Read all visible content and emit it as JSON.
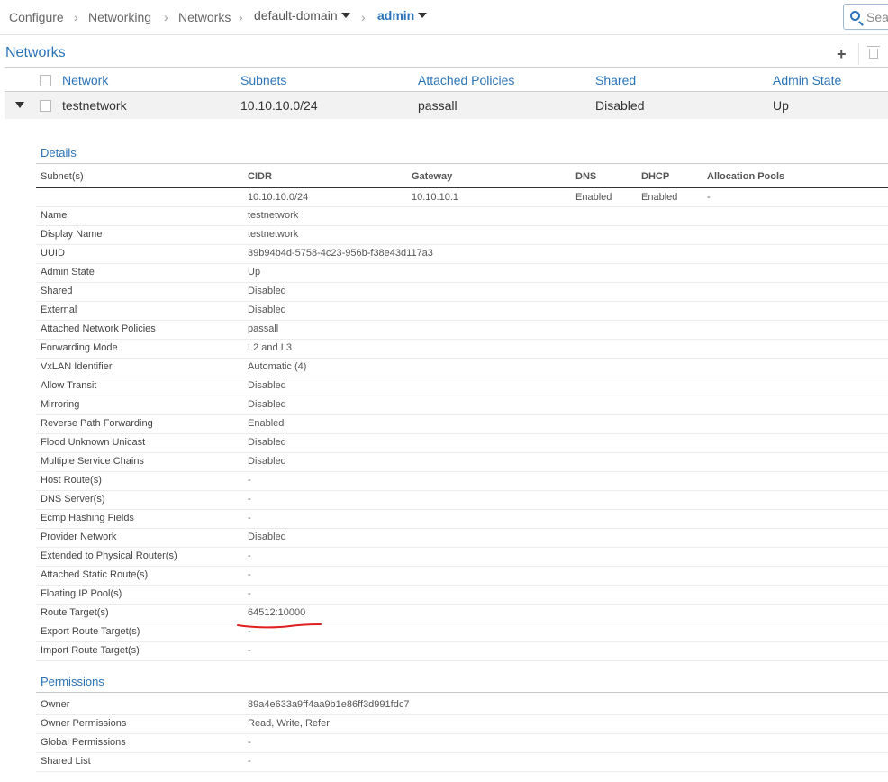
{
  "breadcrumb": {
    "configure": "Configure",
    "networking": "Networking",
    "networks": "Networks",
    "domain": "default-domain",
    "project": "admin",
    "separator": "›"
  },
  "search": {
    "placeholder": "Sear"
  },
  "section_title": "Networks",
  "toolbar": {
    "add_icon": "plus-icon",
    "delete_icon": "trash-icon"
  },
  "grid": {
    "columns": [
      "Network",
      "Subnets",
      "Attached Policies",
      "Shared",
      "Admin State"
    ],
    "rows": [
      {
        "network": "testnetwork",
        "subnets": "10.10.10.0/24",
        "policies": "passall",
        "shared": "Disabled",
        "admin_state": "Up"
      }
    ]
  },
  "details": {
    "title": "Details",
    "subnet_label": "Subnet(s)",
    "subnet_columns": [
      "CIDR",
      "Gateway",
      "DNS",
      "DHCP",
      "Allocation Pools"
    ],
    "subnet_rows": [
      {
        "cidr": "10.10.10.0/24",
        "gateway": "10.10.10.1",
        "dns": "Enabled",
        "dhcp": "Enabled",
        "pools": "-"
      }
    ],
    "fields": [
      {
        "label": "Name",
        "value": "testnetwork"
      },
      {
        "label": "Display Name",
        "value": "testnetwork"
      },
      {
        "label": "UUID",
        "value": "39b94b4d-5758-4c23-956b-f38e43d117a3"
      },
      {
        "label": "Admin State",
        "value": "Up"
      },
      {
        "label": "Shared",
        "value": "Disabled"
      },
      {
        "label": "External",
        "value": "Disabled"
      },
      {
        "label": "Attached Network Policies",
        "value": "passall"
      },
      {
        "label": "Forwarding Mode",
        "value": "L2 and L3"
      },
      {
        "label": "VxLAN Identifier",
        "value": "Automatic (4)"
      },
      {
        "label": "Allow Transit",
        "value": "Disabled"
      },
      {
        "label": "Mirroring",
        "value": "Disabled"
      },
      {
        "label": "Reverse Path Forwarding",
        "value": "Enabled"
      },
      {
        "label": "Flood Unknown Unicast",
        "value": "Disabled"
      },
      {
        "label": "Multiple Service Chains",
        "value": "Disabled"
      },
      {
        "label": "Host Route(s)",
        "value": "-"
      },
      {
        "label": "DNS Server(s)",
        "value": "-"
      },
      {
        "label": "Ecmp Hashing Fields",
        "value": "-"
      },
      {
        "label": "Provider Network",
        "value": "Disabled"
      },
      {
        "label": "Extended to Physical Router(s)",
        "value": "-"
      },
      {
        "label": "Attached Static Route(s)",
        "value": "-"
      },
      {
        "label": "Floating IP Pool(s)",
        "value": "-"
      },
      {
        "label": "Route Target(s)",
        "value": "64512:10000"
      },
      {
        "label": "Export Route Target(s)",
        "value": "-"
      },
      {
        "label": "Import Route Target(s)",
        "value": "-"
      }
    ]
  },
  "permissions": {
    "title": "Permissions",
    "fields": [
      {
        "label": "Owner",
        "value": "89a4e633a9ff4aa9b1e86ff3d991fdc7"
      },
      {
        "label": "Owner Permissions",
        "value": "Read, Write, Refer"
      },
      {
        "label": "Global Permissions",
        "value": "-"
      },
      {
        "label": "Shared List",
        "value": "-"
      }
    ]
  },
  "colors": {
    "accent": "#2a73b8",
    "annotation": "#e02020"
  }
}
